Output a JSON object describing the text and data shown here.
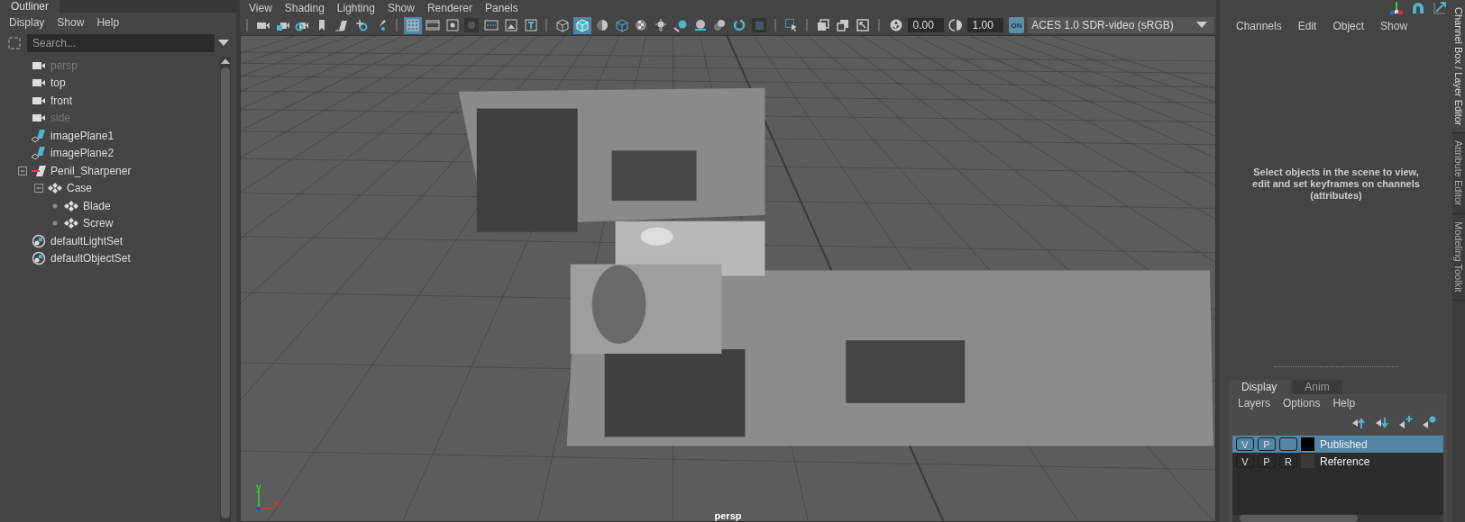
{
  "outliner": {
    "tab": "Outliner",
    "menu": [
      "Display",
      "Show",
      "Help"
    ],
    "search": {
      "placeholder": "Search..."
    },
    "items": [
      {
        "kind": "camera",
        "label": "persp",
        "dimmed": true
      },
      {
        "kind": "camera",
        "label": "top",
        "dimmed": false
      },
      {
        "kind": "camera",
        "label": "front",
        "dimmed": false
      },
      {
        "kind": "camera",
        "label": "side",
        "dimmed": true
      },
      {
        "kind": "image-plane",
        "label": "imagePlane1",
        "dimmed": false
      },
      {
        "kind": "image-plane",
        "label": "imagePlane2",
        "dimmed": false
      },
      {
        "kind": "group",
        "label": "Penil_Sharpener",
        "dimmed": false,
        "expanded": true,
        "children": [
          {
            "kind": "mesh",
            "label": "Case",
            "dimmed": false,
            "expanded": true,
            "children": [
              {
                "kind": "mesh",
                "label": "Blade",
                "dimmed": false
              },
              {
                "kind": "mesh",
                "label": "Screw",
                "dimmed": false
              }
            ]
          }
        ]
      },
      {
        "kind": "set",
        "label": "defaultLightSet",
        "dimmed": false
      },
      {
        "kind": "set",
        "label": "defaultObjectSet",
        "dimmed": false
      }
    ]
  },
  "viewport": {
    "menu": [
      "View",
      "Shading",
      "Lighting",
      "Show",
      "Renderer",
      "Panels"
    ],
    "toolbar": [
      [
        {
          "kind": "camera",
          "selected": false
        },
        {
          "kind": "camera-lock",
          "selected": false
        },
        {
          "kind": "camera-gear",
          "selected": false
        },
        {
          "kind": "bookmark",
          "selected": false
        },
        {
          "kind": "image-plane",
          "selected": false
        },
        {
          "kind": "pick",
          "selected": false
        },
        {
          "kind": "brush",
          "selected": false
        }
      ],
      [
        {
          "kind": "grid",
          "selected": true
        },
        {
          "kind": "film",
          "selected": false
        },
        {
          "kind": "dot",
          "selected": false
        },
        {
          "kind": "dark-dot",
          "selected": false
        },
        {
          "kind": "safe",
          "selected": false
        },
        {
          "kind": "gate",
          "selected": false
        },
        {
          "kind": "t-shape",
          "selected": false
        }
      ],
      [
        {
          "kind": "wire-cube",
          "selected": false
        },
        {
          "kind": "solid-cube",
          "selected": true
        },
        {
          "kind": "half-sphere",
          "selected": false
        },
        {
          "kind": "xray-cube",
          "selected": false
        },
        {
          "kind": "checker",
          "selected": false
        },
        {
          "kind": "light",
          "selected": false
        },
        {
          "kind": "shadow",
          "selected": false
        },
        {
          "kind": "ball",
          "selected": false
        },
        {
          "kind": "balls",
          "selected": false
        },
        {
          "kind": "ring",
          "selected": false
        },
        {
          "kind": "dark-square",
          "selected": false
        }
      ],
      [
        {
          "kind": "select",
          "selected": false
        }
      ],
      [
        {
          "kind": "iso-a",
          "selected": false
        },
        {
          "kind": "iso-b",
          "selected": false
        },
        {
          "kind": "frame",
          "selected": false
        }
      ]
    ],
    "exposure": "0.00",
    "gamma": "1.00",
    "color_management": {
      "label": "ON",
      "on": true
    },
    "color_space": "ACES 1.0 SDR-video (sRGB)",
    "camera_label": "persp",
    "axis_labels": [
      "y",
      "x"
    ]
  },
  "channel_box": {
    "menu": [
      "Channels",
      "Edit",
      "Object",
      "Show"
    ],
    "message": "Select objects in the scene to view, edit and set keyframes on channels (attributes)"
  },
  "layer_editor": {
    "tabs": [
      {
        "label": "Display",
        "selected": true
      },
      {
        "label": "Anim",
        "selected": false
      }
    ],
    "menu": [
      "Layers",
      "Options",
      "Help"
    ],
    "layers": [
      {
        "name": "Published",
        "selected": true,
        "visibility": "V",
        "playback": "P",
        "color": "#000000"
      },
      {
        "name": "Reference",
        "selected": false,
        "visibility": "V",
        "playback": "P",
        "reference": "R",
        "color": "#3a3a3a"
      }
    ]
  },
  "side_tabs": [
    {
      "label": "Channel Box / Layer Editor",
      "selected": true
    },
    {
      "label": "Attribute Editor",
      "selected": false
    },
    {
      "label": "Modeling Toolkit",
      "selected": false
    }
  ]
}
